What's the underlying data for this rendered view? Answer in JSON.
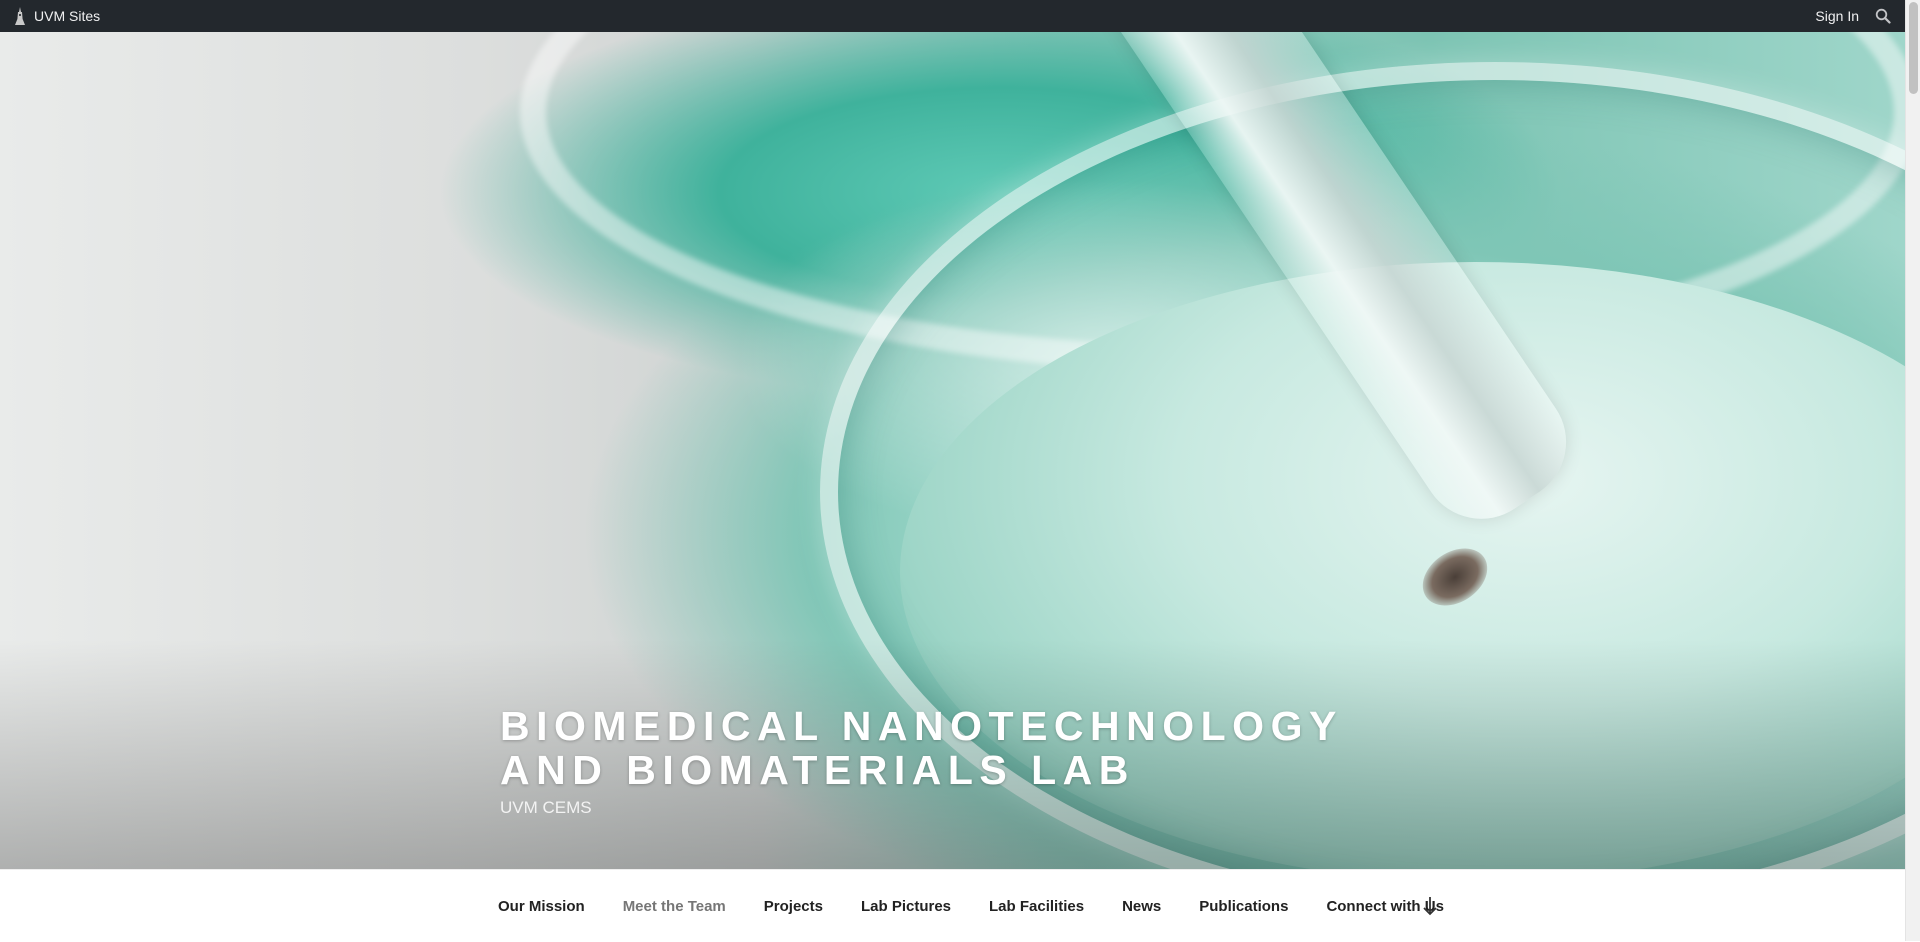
{
  "topbar": {
    "brand_label": "UVM Sites",
    "brand_icon": "uvm-tower-icon",
    "signin_label": "Sign In",
    "search_icon": "search-icon"
  },
  "hero": {
    "site_title": "Biomedical Nanotechnology and Biomaterials Lab",
    "tagline": "UVM CEMS"
  },
  "nav": {
    "items": [
      {
        "label": "Our Mission",
        "current": false
      },
      {
        "label": "Meet the Team",
        "current": true
      },
      {
        "label": "Projects",
        "current": false
      },
      {
        "label": "Lab Pictures",
        "current": false
      },
      {
        "label": "Lab Facilities",
        "current": false
      },
      {
        "label": "News",
        "current": false
      },
      {
        "label": "Publications",
        "current": false
      },
      {
        "label": "Connect with Us",
        "current": false
      }
    ],
    "scroll_icon": "arrow-down-icon"
  },
  "colors": {
    "admin_bar": "#23282d",
    "nav_text": "#222222",
    "nav_current": "#767676",
    "title_text": "#ffffff"
  }
}
